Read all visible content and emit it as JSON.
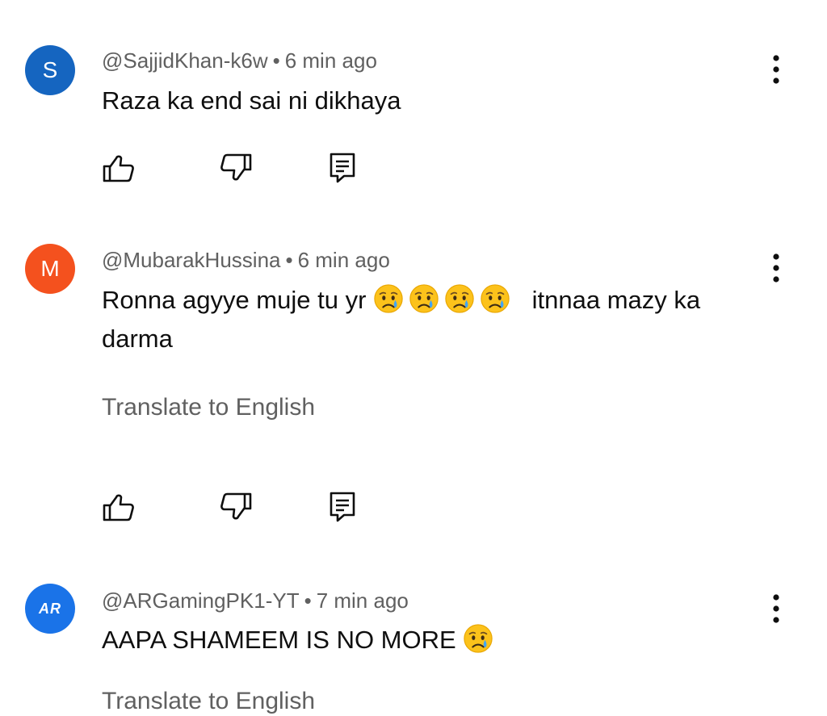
{
  "comments": [
    {
      "avatar_letter": "S",
      "avatar_color": "#1565c0",
      "author": "@SajjidKhan-k6w",
      "separator": "•",
      "time": "6 min ago",
      "text": "Raza ka end sai ni dikhaya"
    },
    {
      "avatar_letter": "M",
      "avatar_color": "#f4511e",
      "author": "@MubarakHussina",
      "separator": "•",
      "time": "6 min ago",
      "text_before": "Ronna agyye muje tu yr",
      "emoji": "crying-face",
      "emoji_count": 4,
      "text_after": "itnnaa mazy ka darma",
      "translate": "Translate to English"
    },
    {
      "avatar_letter": "AR",
      "avatar_color": "#1a73e8",
      "author": "@ARGamingPK1-YT",
      "separator": "•",
      "time": "7 min ago",
      "text": "AAPA SHAMEEM IS NO MORE",
      "emoji": "crying-face",
      "translate_partial": "Translate to English"
    }
  ],
  "icons": {
    "like": "thumb-up-icon",
    "dislike": "thumb-down-icon",
    "reply": "reply-comment-icon",
    "more": "more-vert-icon"
  },
  "colors": {
    "meta_text": "#606060",
    "body_text": "#0f0f0f",
    "emoji_face": "#fcc21b"
  }
}
